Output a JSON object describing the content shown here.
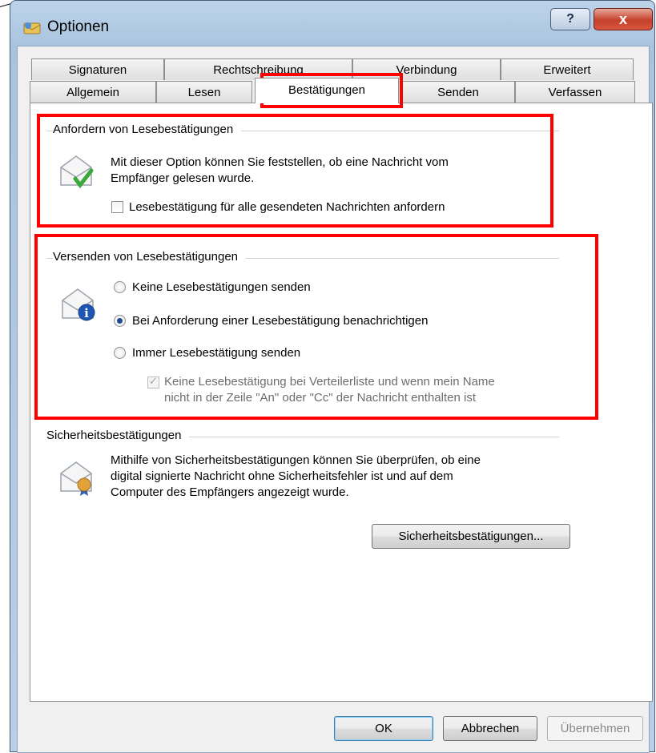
{
  "window": {
    "title": "Optionen",
    "help_label": "?",
    "close_label": "x"
  },
  "tabs": {
    "row_top": [
      "Signaturen",
      "Rechtschreibung",
      "Verbindung",
      "Erweitert"
    ],
    "row_bottom": [
      "Allgemein",
      "Lesen",
      "Bestätigungen",
      "Senden",
      "Verfassen"
    ],
    "active": "Bestätigungen"
  },
  "request_section": {
    "legend": "Anfordern von Lesebestätigungen",
    "description_line1": "Mit dieser Option können Sie feststellen, ob eine Nachricht vom",
    "description_line2": "Empfänger gelesen wurde.",
    "checkbox_label": "Lesebestätigung für alle gesendeten Nachrichten anfordern",
    "checkbox_checked": false
  },
  "send_section": {
    "legend": "Versenden von Lesebestätigungen",
    "options": [
      {
        "label": "Keine Lesebestätigungen senden",
        "selected": false
      },
      {
        "label": "Bei Anforderung einer Lesebestätigung benachrichtigen",
        "selected": true
      },
      {
        "label": "Immer Lesebestätigung senden",
        "selected": false
      }
    ],
    "sub_checkbox_line1": "Keine Lesebestätigung bei Verteilerliste und wenn mein Name",
    "sub_checkbox_line2": "nicht in der Zeile \"An\" oder \"Cc\" der Nachricht enthalten ist",
    "sub_checkbox_checked": true,
    "sub_checkbox_enabled": false
  },
  "security_section": {
    "legend": "Sicherheitsbestätigungen",
    "description_line1": "Mithilfe von Sicherheitsbestätigungen können Sie überprüfen, ob eine",
    "description_line2": "digital signierte Nachricht ohne Sicherheitsfehler ist und auf dem",
    "description_line3": "Computer des Empfängers angezeigt wurde.",
    "button_label": "Sicherheitsbestätigungen..."
  },
  "footer": {
    "ok_label": "OK",
    "cancel_label": "Abbrechen",
    "apply_label": "Übernehmen",
    "apply_enabled": false
  },
  "colors": {
    "highlight_box": "#ff0000",
    "window_frame": "#a9c3df",
    "check_green": "#3aa83a",
    "info_blue": "#1f55b5"
  },
  "icons": {
    "title": "outlook-express-icon",
    "request": "envelope-check-icon",
    "send": "envelope-info-icon",
    "security": "envelope-certificate-icon"
  }
}
